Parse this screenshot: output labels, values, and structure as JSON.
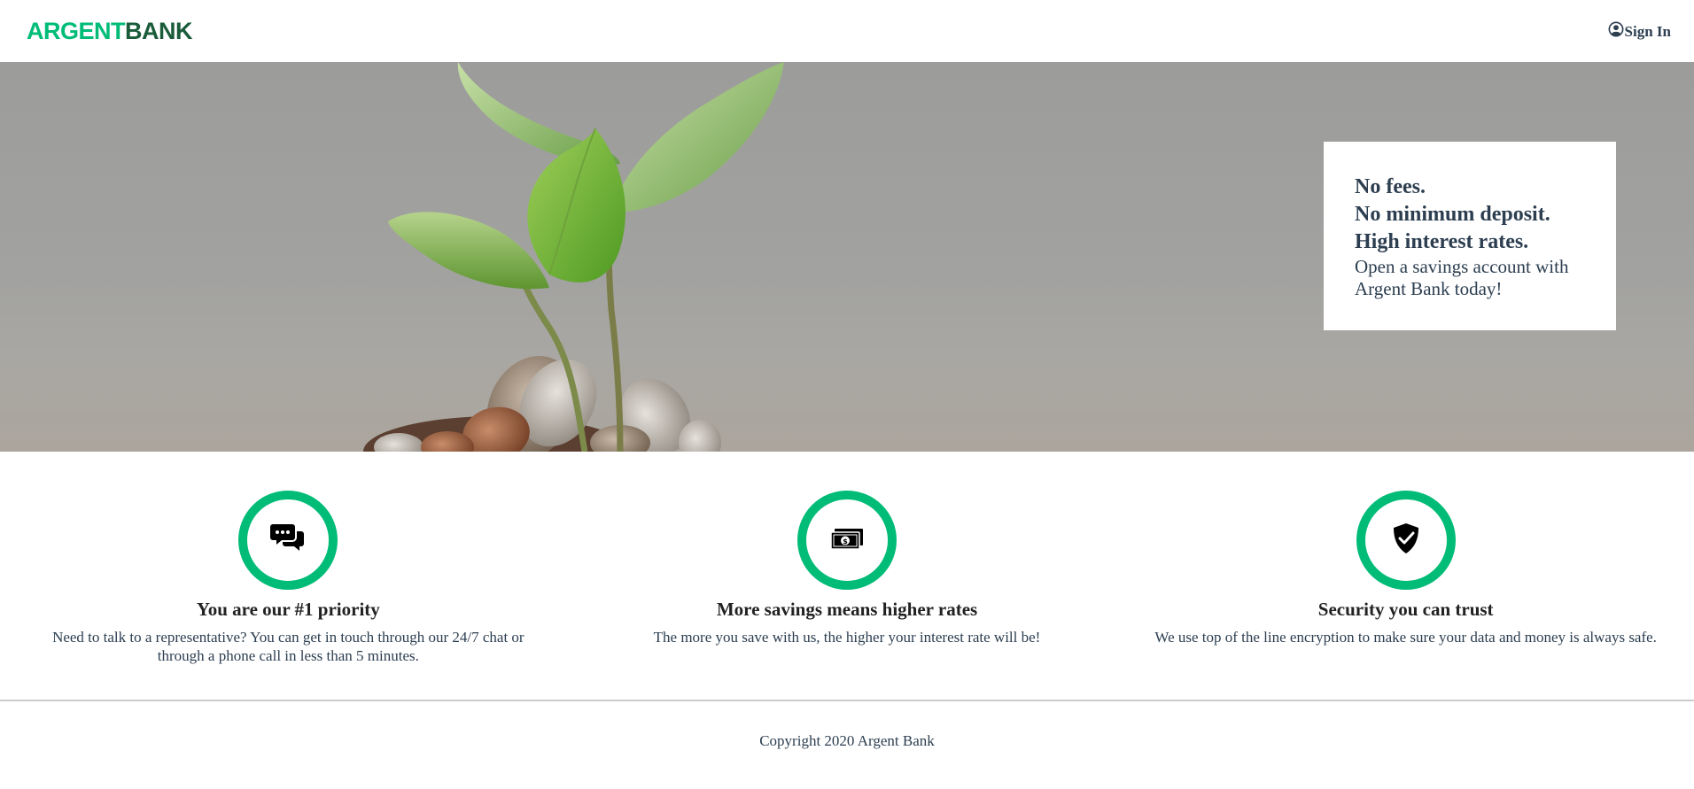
{
  "nav": {
    "logo_part1": "ARGENT",
    "logo_part2": "BANK",
    "signin_label": "Sign In",
    "user_icon": "user-circle-icon"
  },
  "hero": {
    "subtitles": [
      "No fees.",
      "No minimum deposit.",
      "High interest rates."
    ],
    "text": "Open a savings account with Argent Bank today!"
  },
  "features": [
    {
      "icon": "chat-icon",
      "title": "You are our #1 priority",
      "text": "Need to talk to a representative? You can get in touch through our 24/7 chat or through a phone call in less than 5 minutes."
    },
    {
      "icon": "money-icon",
      "title": "More savings means higher rates",
      "text": "The more you save with us, the higher your interest rate will be!"
    },
    {
      "icon": "security-icon",
      "title": "Security you can trust",
      "text": "We use top of the line encryption to make sure your data and money is always safe."
    }
  ],
  "footer": {
    "copyright": "Copyright 2020 Argent Bank"
  },
  "colors": {
    "accent": "#00bc77",
    "logo_dark": "#1a5c3a",
    "text": "#2c3e50"
  }
}
